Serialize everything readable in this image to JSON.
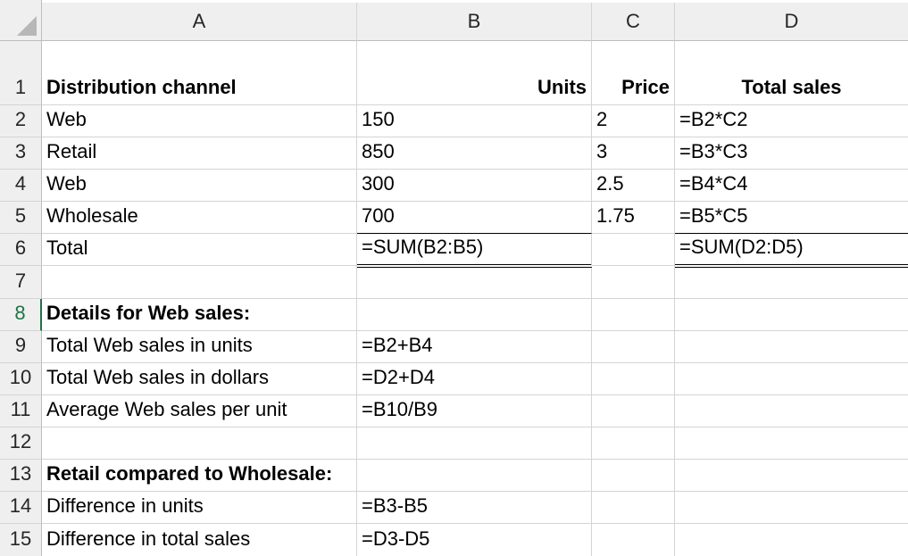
{
  "columns": [
    "A",
    "B",
    "C",
    "D"
  ],
  "rows": [
    "1",
    "2",
    "3",
    "4",
    "5",
    "6",
    "7",
    "8",
    "9",
    "10",
    "11",
    "12",
    "13",
    "14",
    "15"
  ],
  "cells": {
    "A1": "Distribution channel",
    "B1": "Units",
    "C1": "Price",
    "D1": "Total sales",
    "A2": "Web",
    "B2": "150",
    "C2": "2",
    "D2": "=B2*C2",
    "A3": "Retail",
    "B3": "850",
    "C3": "3",
    "D3": "=B3*C3",
    "A4": "Web",
    "B4": "300",
    "C4": "2.5",
    "D4": "=B4*C4",
    "A5": "Wholesale",
    "B5": "700",
    "C5": "1.75",
    "D5": "=B5*C5",
    "A6": "Total",
    "B6": "=SUM(B2:B5)",
    "D6": "=SUM(D2:D5)",
    "A8": "Details for Web sales:",
    "A9": "Total Web sales in units",
    "B9": "=B2+B4",
    "A10": "Total Web sales in dollars",
    "B10": "=D2+D4",
    "A11": "Average Web sales per unit",
    "B11": "=B10/B9",
    "A13": "Retail compared to Wholesale:",
    "A14": "Difference in units",
    "B14": "=B3-B5",
    "A15": "Difference in total sales",
    "B15": "=D3-D5"
  },
  "selected_row": "8",
  "colors": {
    "header_bg": "#efefef",
    "gridline": "#d4d4d4",
    "accent": "#217346"
  }
}
